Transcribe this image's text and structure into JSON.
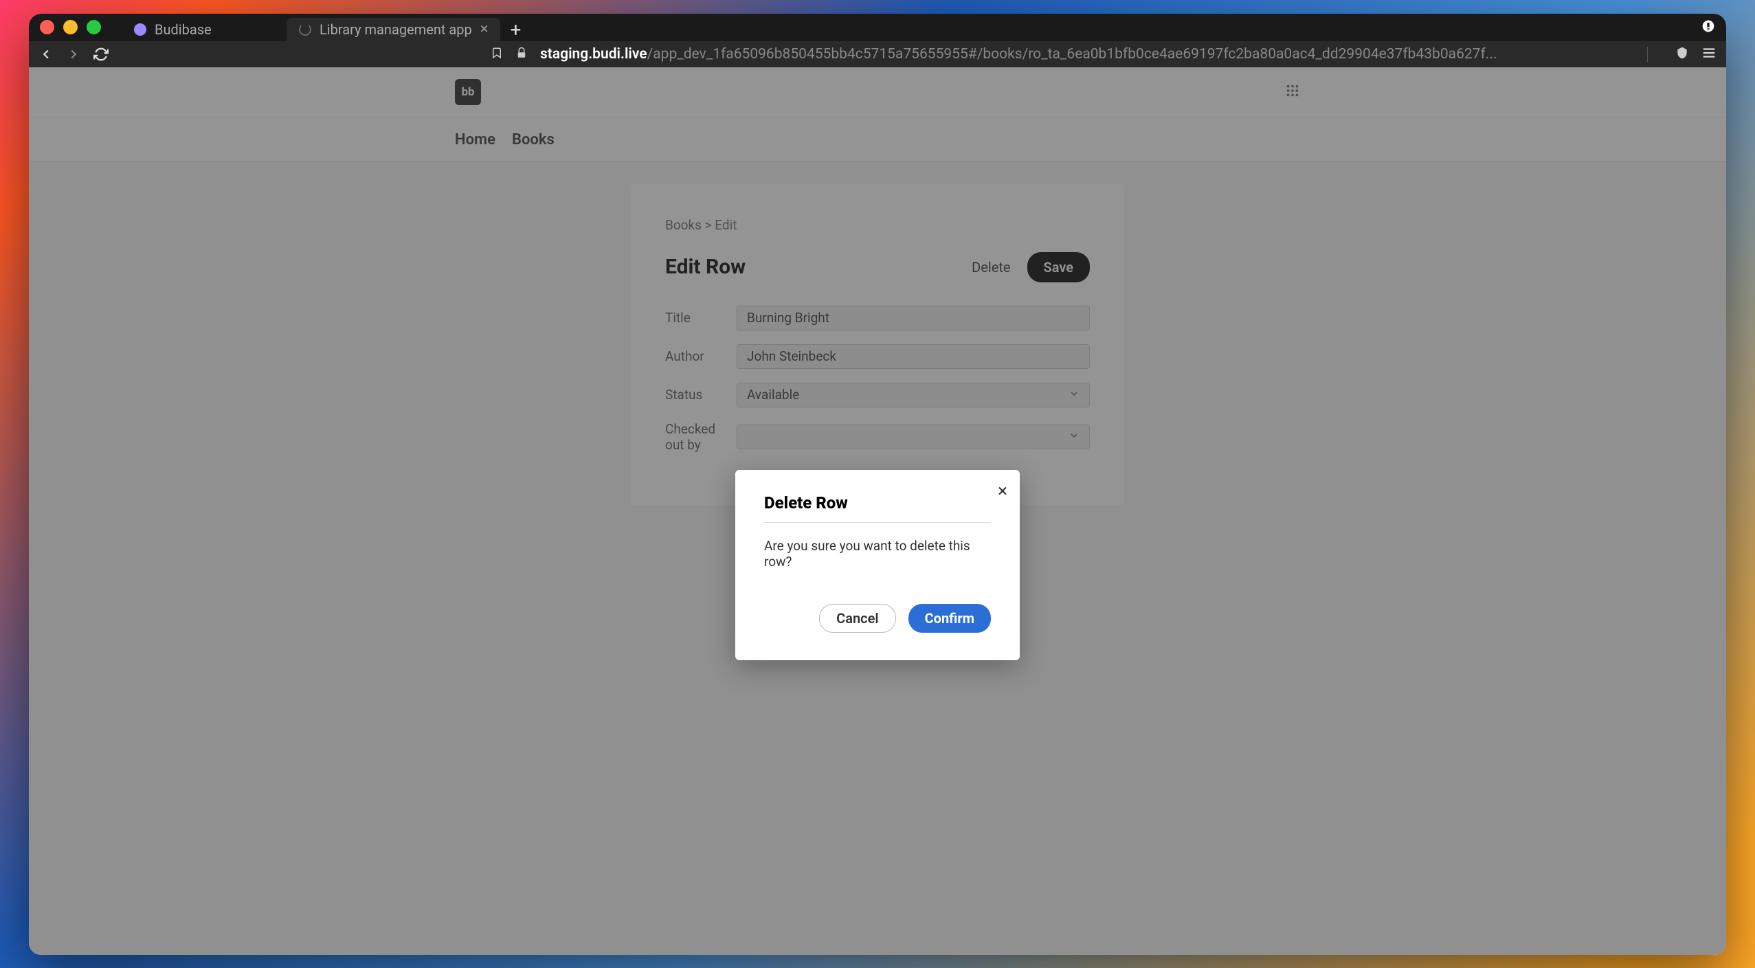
{
  "browser": {
    "tabs": [
      {
        "title": "Budibase",
        "active": false
      },
      {
        "title": "Library management app",
        "active": true
      }
    ],
    "url": {
      "host": "staging.budi.live",
      "path": "/app_dev_1fa65096b850455bb4c5715a75655955#/books/ro_ta_6ea0b1bfb0ce4ae69197fc2ba80a0ac4_dd29904e37fb43b0a627f..."
    }
  },
  "app": {
    "logo_text": "bb",
    "nav": [
      "Home",
      "Books"
    ]
  },
  "page": {
    "breadcrumb": "Books  >  Edit",
    "title": "Edit Row",
    "actions": {
      "delete_label": "Delete",
      "save_label": "Save"
    },
    "fields": {
      "title": {
        "label": "Title",
        "value": "Burning Bright"
      },
      "author": {
        "label": "Author",
        "value": "John Steinbeck"
      },
      "status": {
        "label": "Status",
        "value": "Available"
      },
      "checked_out_by": {
        "label": "Checked out by",
        "value": ""
      }
    }
  },
  "modal": {
    "title": "Delete Row",
    "body": "Are you sure you want to delete this row?",
    "cancel_label": "Cancel",
    "confirm_label": "Confirm"
  }
}
